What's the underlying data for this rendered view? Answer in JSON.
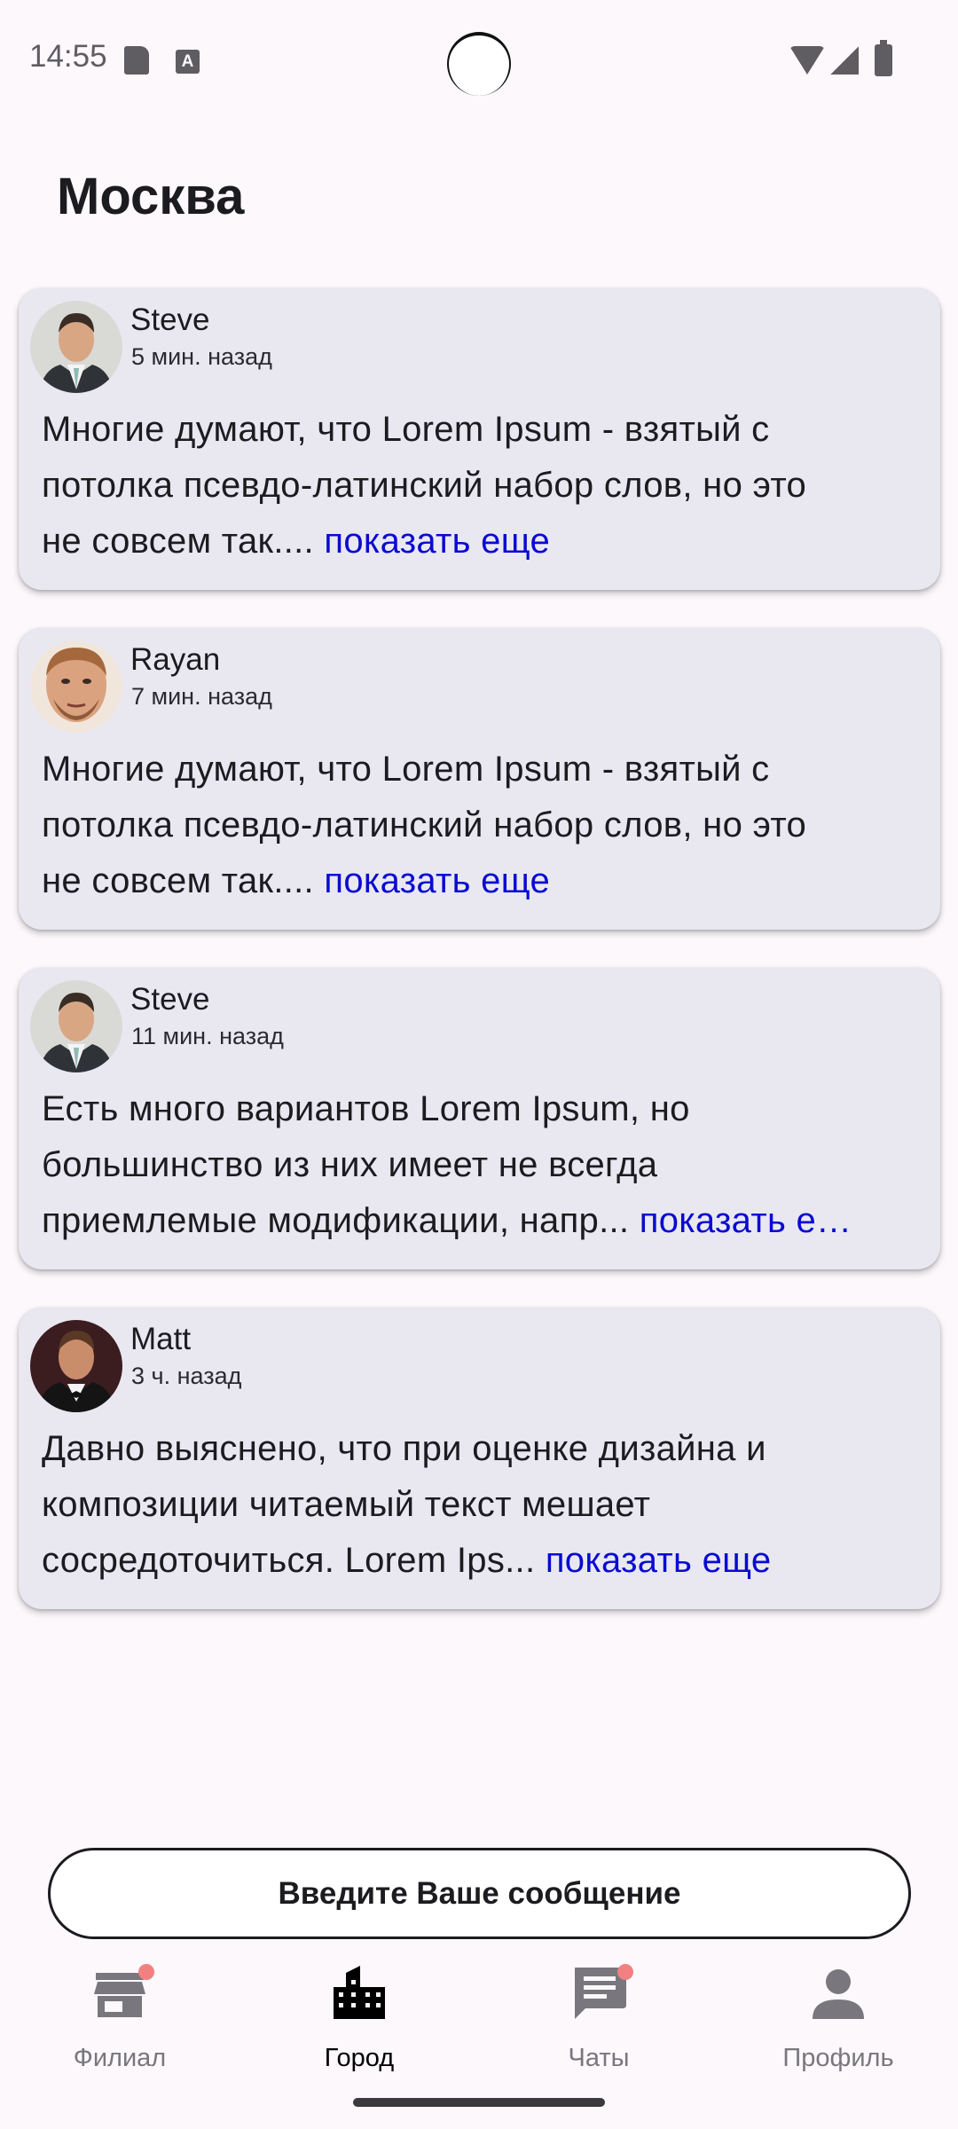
{
  "status_bar": {
    "time": "14:55",
    "a_badge": "A"
  },
  "header": {
    "title": "Москва"
  },
  "posts": [
    {
      "author": "Steve",
      "time": "5 мин. назад",
      "avatar_icon": "person-avatar-steve",
      "lines": [
        "Многие думают, что Lorem Ipsum - взятый с",
        "потолка псевдо-латинский набор слов, но это"
      ],
      "last_line": "не совсем так....",
      "more": "показать еще"
    },
    {
      "author": "Rayan",
      "time": "7 мин. назад",
      "avatar_icon": "person-avatar-rayan",
      "lines": [
        "Многие думают, что Lorem Ipsum - взятый с",
        "потолка псевдо-латинский набор слов, но это"
      ],
      "last_line": "не совсем так....",
      "more": "показать еще"
    },
    {
      "author": "Steve",
      "time": "11 мин. назад",
      "avatar_icon": "person-avatar-steve",
      "lines": [
        "Есть много вариантов Lorem Ipsum, но",
        "большинство из них имеет не всегда"
      ],
      "last_line": "приемлемые модификации, напр...",
      "more": "показать е…"
    },
    {
      "author": "Matt",
      "time": "3 ч. назад",
      "avatar_icon": "person-avatar-matt",
      "lines": [
        "Давно выяснено, что при оценке дизайна и",
        "композиции читаемый текст мешает"
      ],
      "last_line": "сосредоточиться. Lorem Ips...",
      "more": "показать еще"
    }
  ],
  "composer": {
    "placeholder": "Введите Ваше сообщение"
  },
  "nav": {
    "items": [
      {
        "label": "Филиал",
        "icon": "store-icon",
        "active": false,
        "badge": true
      },
      {
        "label": "Город",
        "icon": "city-icon",
        "active": true,
        "badge": false
      },
      {
        "label": "Чаты",
        "icon": "chat-icon",
        "active": false,
        "badge": true
      },
      {
        "label": "Профиль",
        "icon": "person-icon",
        "active": false,
        "badge": false
      }
    ]
  },
  "colors": {
    "background": "#fcf8fc",
    "card": "#e9e8f1",
    "link": "#0a0ad2",
    "badge": "#f28080",
    "inactive": "#79777d"
  }
}
